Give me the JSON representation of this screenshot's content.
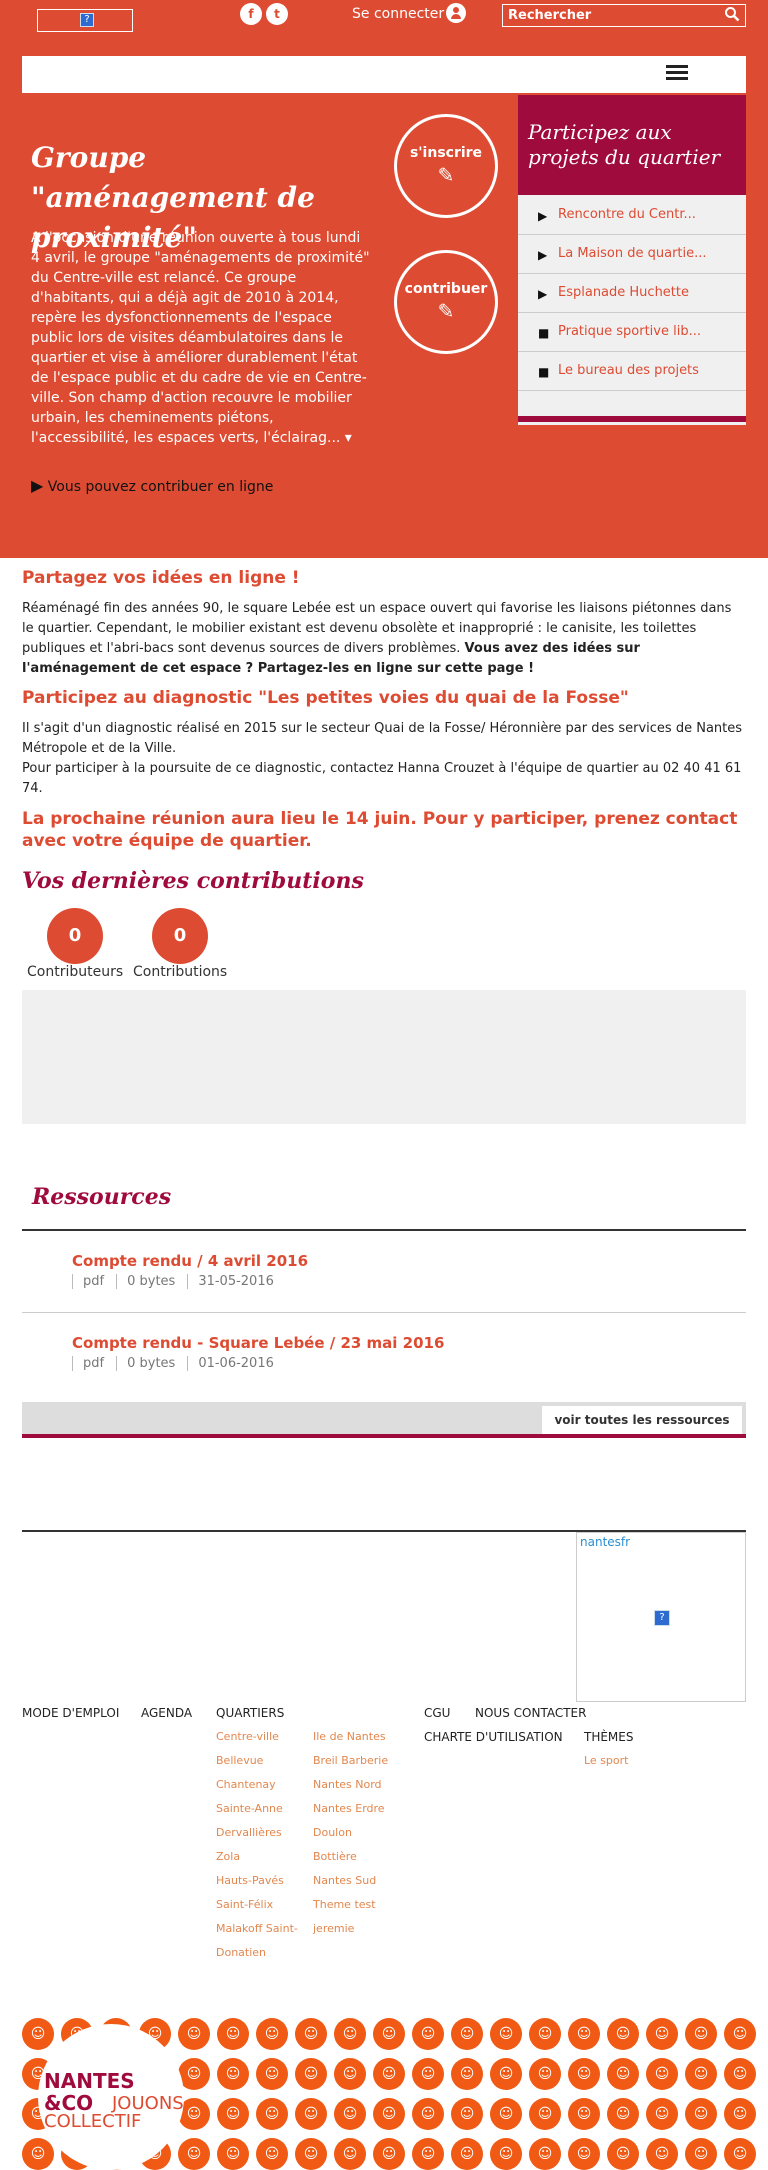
{
  "header": {
    "logo_placeholder": "?",
    "social": [
      {
        "icon": "facebook-icon",
        "glyph": "f"
      },
      {
        "icon": "twitter-icon",
        "glyph": "t"
      }
    ],
    "login_label": "Se connecter",
    "search_placeholder": "Rechercher"
  },
  "hero": {
    "title": "Groupe \"aménagement de proximité\"",
    "text": "A l'occasion d'une réunion ouverte à tous lundi 4 avril, le groupe \"aménagements de proximité\" du Centre-ville est relancé. Ce groupe d'habitants, qui a déjà agit de 2010 à 2014, repère les dysfonctionnements de l'espace public lors de visites déambulatoires dans le quartier et vise à améliorer durablement l'état de l'espace public et du cadre de vie en Centre-ville. Son champ d'action recouvre le mobilier urbain, les cheminements piétons, l'accessibilité, les espaces verts, l'éclairag... ▾",
    "link": "Vous pouvez contribuer en ligne",
    "signup_label": "s'inscrire",
    "contribute_label": "contribuer"
  },
  "projects": {
    "title": "Participez aux projets du quartier",
    "items": [
      {
        "label": "Rencontre du Centr...",
        "marker": "triangle"
      },
      {
        "label": "La Maison de quartie...",
        "marker": "triangle"
      },
      {
        "label": "Esplanade Huchette",
        "marker": "triangle"
      },
      {
        "label": "Pratique sportive lib...",
        "marker": "square"
      },
      {
        "label": "Le bureau des projets",
        "marker": "square"
      }
    ]
  },
  "content": {
    "h1": "Partagez vos idées en ligne !",
    "p1": "Réaménagé fin des années 90, le square Lebée est un espace ouvert qui favorise les liaisons piétonnes dans le quartier. Cependant, le mobilier existant est devenu obsolète et inapproprié : le canisite, les toilettes publiques et l'abri-bacs sont devenus sources de divers problèmes.",
    "p1_bold": "Vous avez des idées sur l'aménagement de cet espace ? Partagez-les en ligne sur cette page !",
    "h2": "Participez au diagnostic \"Les petites voies du quai de la Fosse\"",
    "p2a": "Il s'agit d'un diagnostic réalisé en 2015 sur le secteur Quai de la Fosse/ Héronnière par des services de Nantes Métropole et de la Ville.",
    "p2b": "Pour participer à la poursuite de ce diagnostic, contactez Hanna Crouzet à l'équipe de quartier au 02 40 41 61 74.",
    "h3": "La prochaine réunion aura lieu le 14 juin. Pour y participer, prenez contact avec votre équipe de quartier."
  },
  "contributions": {
    "title": "Vos dernières contributions",
    "contributors_count": "0",
    "contributors_label": "Contributeurs",
    "contributions_count": "0",
    "contributions_label": "Contributions"
  },
  "resources": {
    "title": "Ressources",
    "items": [
      {
        "title": "Compte rendu / 4 avril 2016",
        "type": "pdf",
        "size": "0 bytes",
        "date": "31-05-2016"
      },
      {
        "title": "Compte rendu - Square Lebée / 23 mai 2016",
        "type": "pdf",
        "size": "0 bytes",
        "date": "01-06-2016"
      }
    ],
    "all_label": "voir toutes les ressources"
  },
  "twitter": {
    "handle": "nantesfr",
    "placeholder": "?"
  },
  "footer": {
    "mode_emploi": "MODE D'EMPLOI",
    "agenda": "AGENDA",
    "quartiers": "QUARTIERS",
    "quartiers_col1": [
      "Centre-ville",
      "Bellevue",
      "Chantenay",
      "Sainte-Anne",
      "Dervallières",
      "Zola",
      "Hauts-Pavés",
      "Saint-Félix",
      "Malakoff Saint-",
      "Donatien"
    ],
    "quartiers_col2": [
      "Ile de Nantes",
      "Breil Barberie",
      "Nantes Nord",
      "Nantes Erdre",
      "Doulon",
      "Bottière",
      "Nantes Sud",
      "Theme test",
      "jeremie"
    ],
    "cgu": "CGU",
    "contact": "NOUS CONTACTER",
    "charte": "CHARTE D'UTILISATION",
    "themes": "THÈMES",
    "themes_items": [
      "Le sport"
    ],
    "brand_line1": "NANTES",
    "brand_line2a": "&CO",
    "brand_line2b": "JOUONS",
    "brand_line3": "COLLECTIF"
  }
}
